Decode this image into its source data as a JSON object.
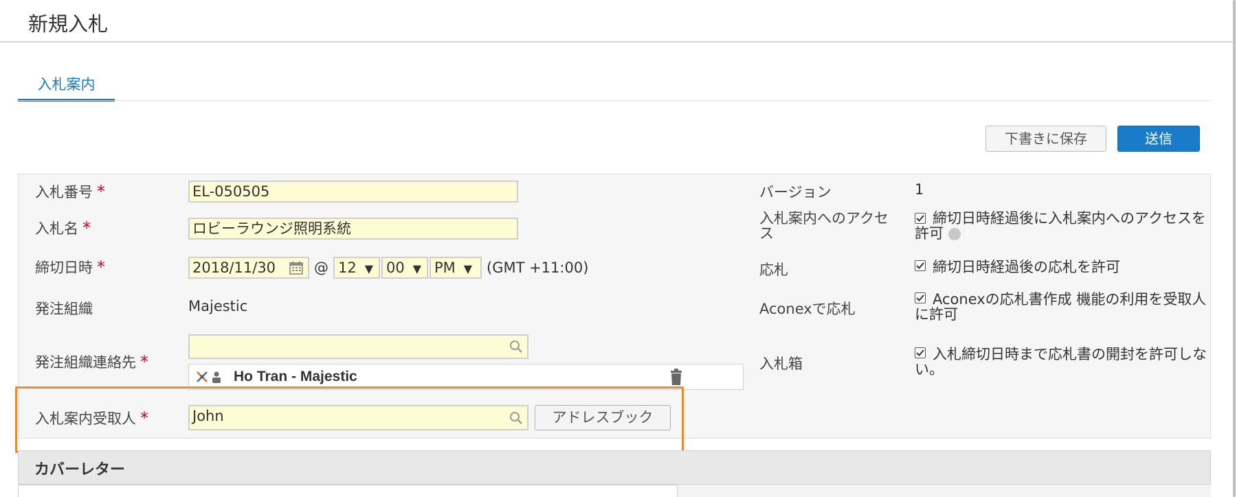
{
  "header": {
    "title": "新規入札"
  },
  "tabs": [
    {
      "label": "入札案内"
    }
  ],
  "actions": {
    "save_draft": "下書きに保存",
    "send": "送信"
  },
  "form": {
    "bid_number": {
      "label": "入札番号",
      "value": "EL-050505"
    },
    "bid_name": {
      "label": "入札名",
      "value": "ロビーラウンジ照明系統"
    },
    "deadline": {
      "label": "締切日時",
      "date": "2018/11/30",
      "at": "@",
      "hour": "12",
      "minute": "00",
      "ampm": "PM",
      "timezone": "(GMT +11:00)"
    },
    "issuer_org": {
      "label": "発注組織",
      "value": "Majestic"
    },
    "issuer_contact": {
      "label": "発注組織連絡先",
      "search_value": "",
      "selected": "Ho Tran - Majestic"
    },
    "recipients": {
      "label": "入札案内受取人",
      "value": "John",
      "address_book": "アドレスブック"
    },
    "required_mark": "*"
  },
  "side": {
    "version": {
      "label": "バージョン",
      "value": "1"
    },
    "access": {
      "label": "入札案内へのアクセス",
      "text": "締切日時経過後に入札案内へのアクセスを許可",
      "info": "i"
    },
    "bidding": {
      "label": "応札",
      "text": "締切日時経過後の応札を許可"
    },
    "aconex": {
      "label": "Aconexで応札",
      "text": "Aconexの応札書作成 機能の利用を受取人に許可"
    },
    "tender_box": {
      "label": "入札箱",
      "text": "入札締切日時まで応札書の開封を許可しない。"
    }
  },
  "cover_letter": {
    "title": "カバーレター"
  },
  "colors": {
    "accent": "#1a79c2",
    "field_bg": "#fefcd4",
    "highlight": "#ef8a2c",
    "required": "#d0021b"
  }
}
